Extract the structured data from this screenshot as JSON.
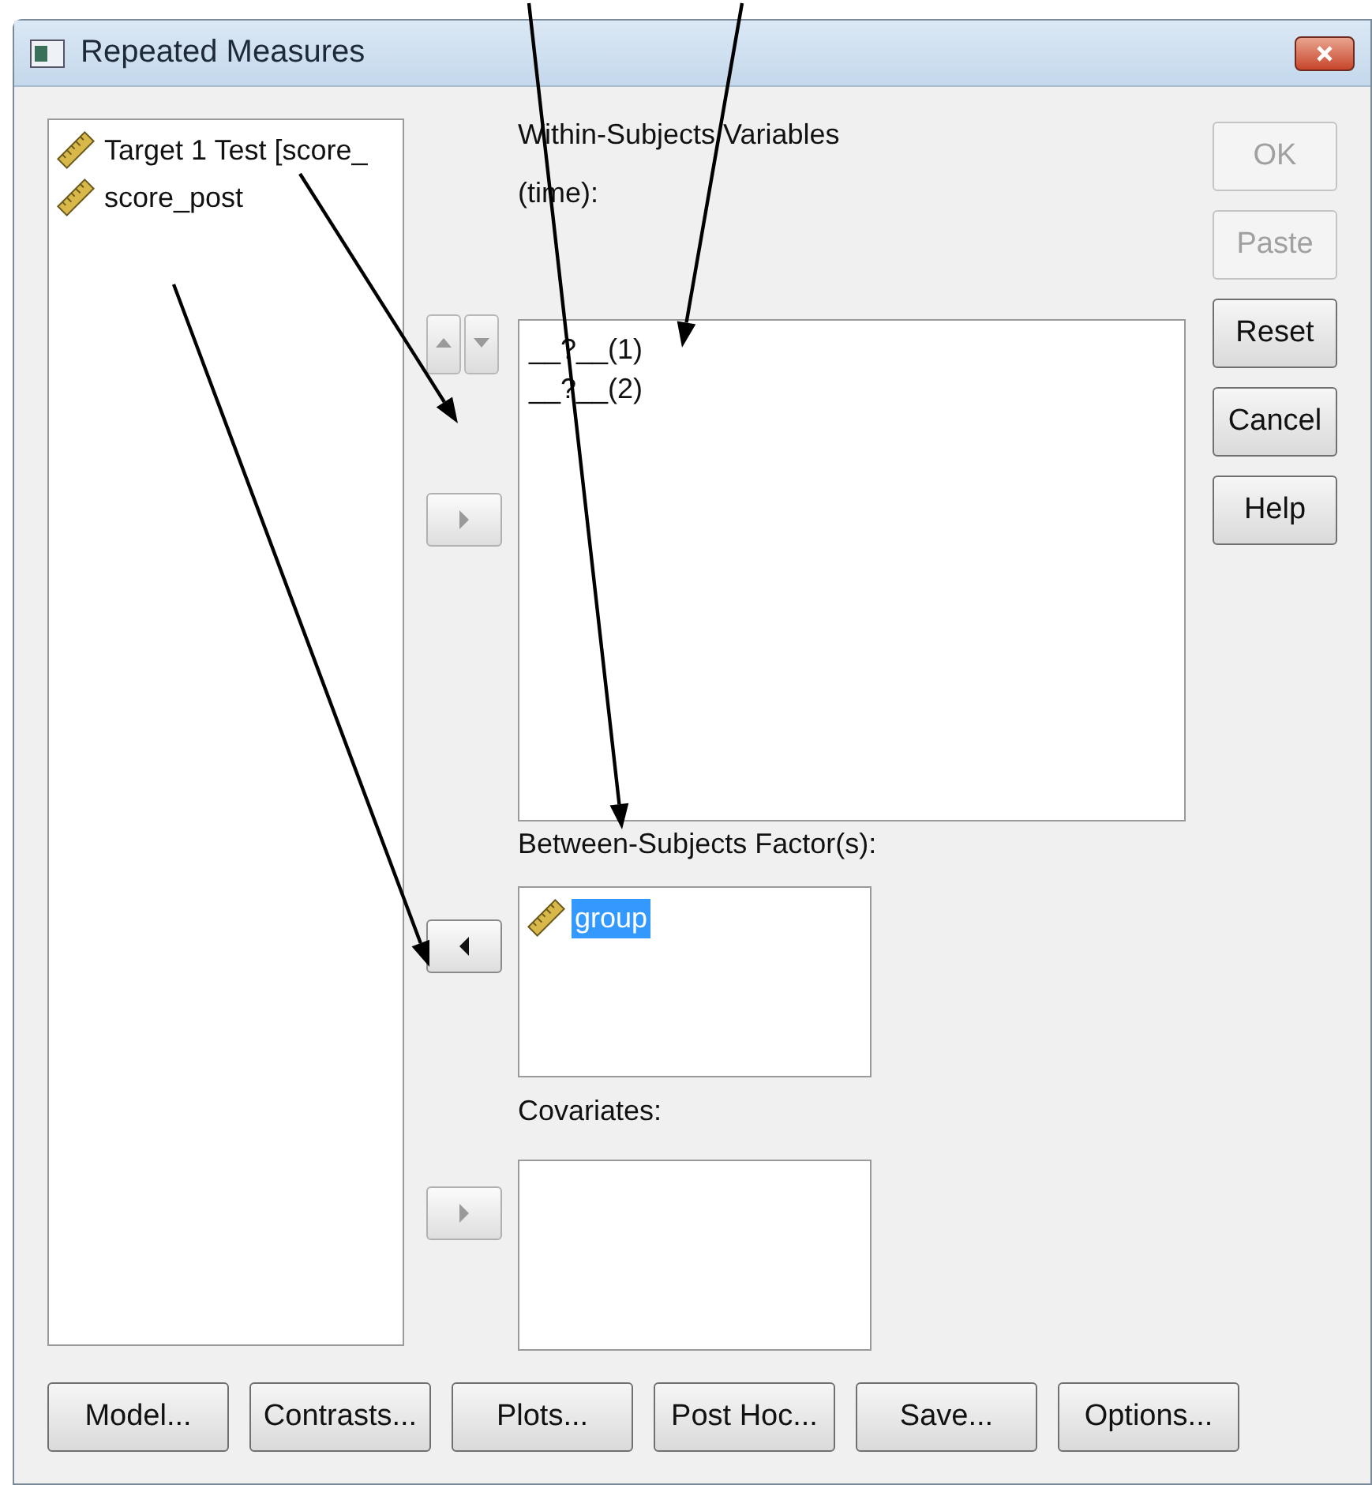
{
  "window": {
    "title": "Repeated Measures"
  },
  "variables": [
    {
      "name": "Target 1 Test [score_",
      "selected": false
    },
    {
      "name": "score_post",
      "selected": false
    }
  ],
  "within": {
    "label": "Within-Subjects Variables",
    "sublabel": "(time):",
    "items": [
      {
        "name": "__?__(1)",
        "selected": false
      },
      {
        "name": "__?__(2)",
        "selected": false
      }
    ]
  },
  "order_buttons": [
    {
      "kind": "up",
      "disabled": true
    },
    {
      "kind": "down",
      "disabled": true
    }
  ],
  "within_move": {
    "kind": "right",
    "disabled": true
  },
  "between": {
    "label": "Between-Subjects Factor(s):",
    "move": {
      "kind": "left",
      "disabled": false
    },
    "items": [
      {
        "name": "group",
        "selected": true
      }
    ]
  },
  "covariates": {
    "label": "Covariates:",
    "move": {
      "kind": "right",
      "disabled": true
    }
  },
  "side_buttons": [
    {
      "label": "OK",
      "disabled": true
    },
    {
      "label": "Paste",
      "disabled": true
    },
    {
      "label": "Reset",
      "disabled": false
    },
    {
      "label": "Cancel",
      "disabled": false
    },
    {
      "label": "Help",
      "disabled": false
    }
  ],
  "bottom_buttons": [
    {
      "label": "Model..."
    },
    {
      "label": "Contrasts..."
    },
    {
      "label": "Plots..."
    },
    {
      "label": "Post Hoc..."
    },
    {
      "label": "Save..."
    },
    {
      "label": "Options..."
    }
  ]
}
